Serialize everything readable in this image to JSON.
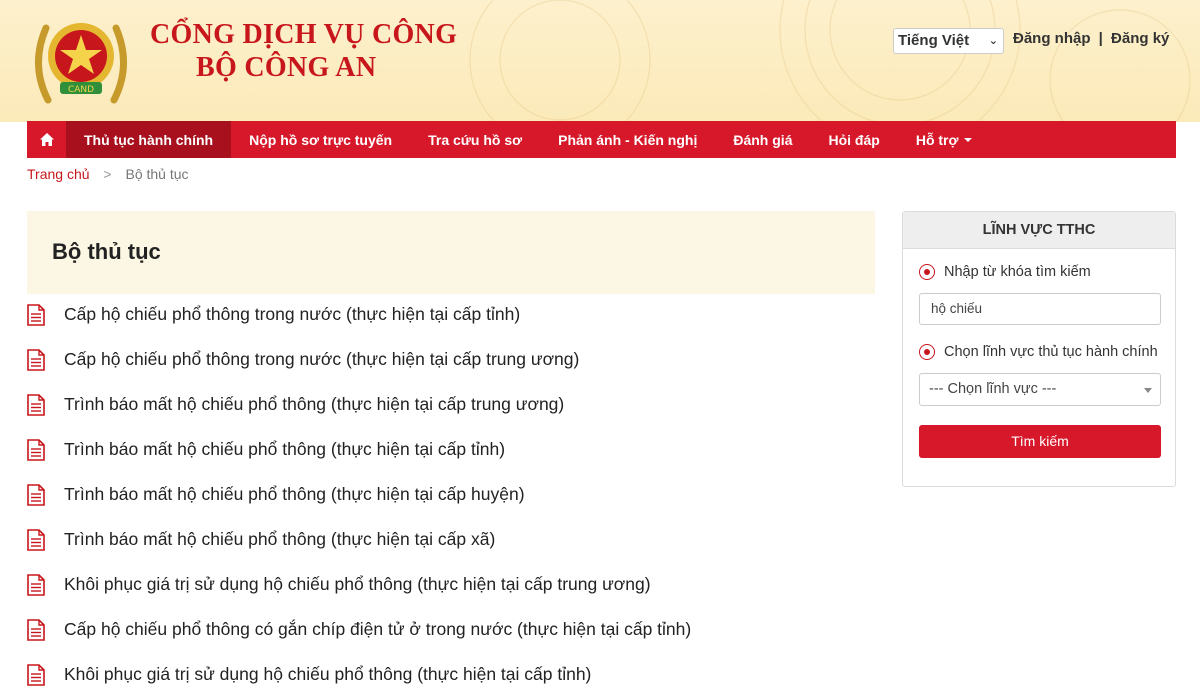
{
  "header": {
    "title_line1": "CỔNG DỊCH VỤ CÔNG",
    "title_line2": "BỘ CÔNG AN",
    "language": "Tiếng Việt",
    "login_label": "Đăng nhập",
    "divider": "|",
    "register_label": "Đăng ký"
  },
  "nav": {
    "home_icon": "home-icon",
    "items": [
      {
        "label": "Thủ tục hành chính"
      },
      {
        "label": "Nộp hồ sơ trực tuyến"
      },
      {
        "label": "Tra cứu hồ sơ"
      },
      {
        "label": "Phản ánh - Kiến nghị"
      },
      {
        "label": "Đánh giá"
      },
      {
        "label": "Hỏi đáp"
      },
      {
        "label": "Hỗ trợ"
      }
    ]
  },
  "breadcrumb": {
    "home": "Trang chủ",
    "separator": ">",
    "current": "Bộ thủ tục"
  },
  "main": {
    "title": "Bộ thủ tục",
    "procedures": [
      "Cấp hộ chiếu phổ thông trong nước (thực hiện tại cấp tỉnh)",
      "Cấp hộ chiếu phổ thông trong nước (thực hiện tại cấp trung ương)",
      "Trình báo mất hộ chiếu phổ thông (thực hiện tại cấp trung ương)",
      "Trình báo mất hộ chiếu phổ thông (thực hiện tại cấp tỉnh)",
      "Trình báo mất hộ chiếu phổ thông (thực hiện tại cấp huyện)",
      "Trình báo mất hộ chiếu phổ thông (thực hiện tại cấp xã)",
      "Khôi phục giá trị sử dụng hộ chiếu phổ thông (thực hiện tại cấp trung ương)",
      "Cấp hộ chiếu phổ thông có gắn chíp điện tử ở trong nước (thực hiện tại cấp tỉnh)",
      "Khôi phục giá trị sử dụng hộ chiếu phổ thông (thực hiện tại cấp tỉnh)"
    ]
  },
  "sidebar": {
    "heading": "LĨNH VỰC TTHC",
    "radio_keyword_label": "Nhập từ khóa tìm kiếm",
    "keyword_value": "hộ chiếu",
    "radio_field_label": "Chọn lĩnh vực thủ tục hành chính",
    "field_select_value": "--- Chọn lĩnh vực ---",
    "search_button": "Tìm kiếm"
  },
  "colors": {
    "brand_red": "#d7182a",
    "nav_active": "#a8101e",
    "header_bg": "#fbeab9",
    "title_red": "#c8171c"
  }
}
